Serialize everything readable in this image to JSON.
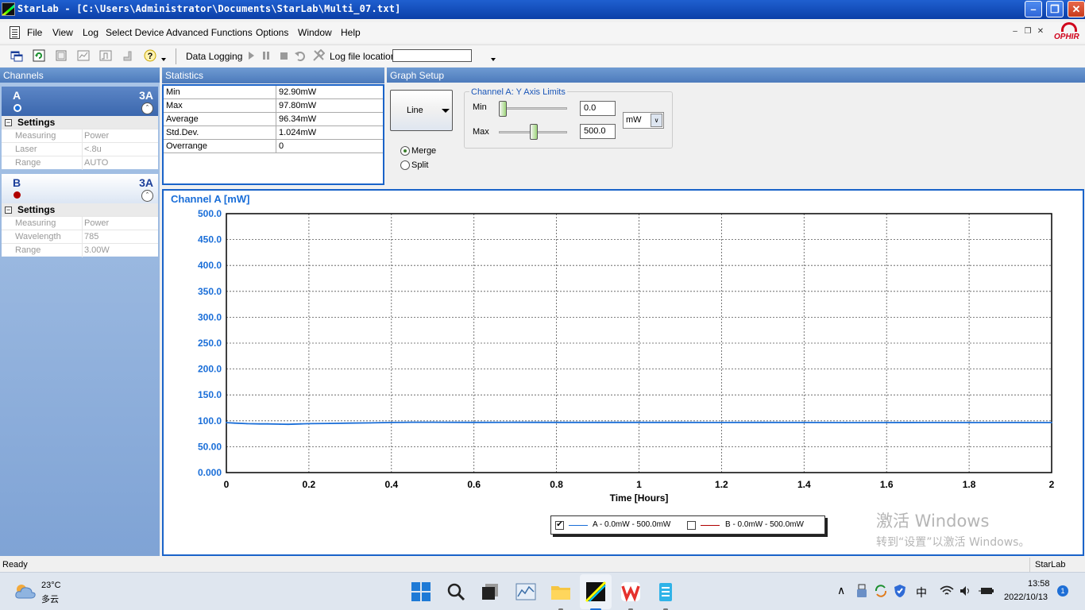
{
  "window": {
    "title": "StarLab - [C:\\Users\\Administrator\\Documents\\StarLab\\Multi_07.txt]",
    "min_glyph": "–",
    "max_glyph": "❐",
    "close_glyph": "✕"
  },
  "menu": {
    "items": [
      "File",
      "View",
      "Log",
      "Select Device",
      "Advanced Functions",
      "Options",
      "Window",
      "Help"
    ],
    "mdi_min": "–",
    "mdi_restore": "❐",
    "mdi_close": "✕",
    "brand": "OPHIR"
  },
  "toolbar": {
    "help_glyph": "?",
    "data_logging": "Data Logging",
    "log_file_location": "Log file location",
    "log_file_value": ""
  },
  "panels": {
    "channels": "Channels",
    "statistics": "Statistics",
    "graph_setup": "Graph Setup"
  },
  "channels": [
    {
      "letter": "A",
      "model": "3A",
      "color": "#1a6ed8",
      "settings_label": "Settings",
      "expander": "−",
      "collapse_glyph": "ˆ",
      "props": [
        {
          "k": "Measuring",
          "v": "Power"
        },
        {
          "k": "Laser",
          "v": "<.8u"
        },
        {
          "k": "Range",
          "v": "AUTO"
        }
      ]
    },
    {
      "letter": "B",
      "model": "3A",
      "color": "#b00000",
      "settings_label": "Settings",
      "expander": "−",
      "collapse_glyph": "ˆ",
      "props": [
        {
          "k": "Measuring",
          "v": "Power"
        },
        {
          "k": "Wavelength",
          "v": "785"
        },
        {
          "k": "Range",
          "v": "3.00W"
        }
      ]
    }
  ],
  "statistics": [
    {
      "k": "Min",
      "v": "92.90mW"
    },
    {
      "k": "Max",
      "v": "97.80mW"
    },
    {
      "k": "Average",
      "v": "96.34mW"
    },
    {
      "k": "Std.Dev.",
      "v": "1.024mW"
    },
    {
      "k": "Overrange",
      "v": "0"
    }
  ],
  "graph_setup": {
    "chart_type_button": "Line",
    "merge_label": "Merge",
    "split_label": "Split",
    "merge_selected": true,
    "y_limits_legend": "Channel A: Y Axis Limits",
    "min_label": "Min",
    "min_value": "0.0",
    "max_label": "Max",
    "max_value": "500.0",
    "unit": "mW",
    "dropdown_glyph": "∨"
  },
  "chart_data": {
    "type": "line",
    "title": "Channel A [mW]",
    "xlabel": "Time [Hours]",
    "ylabel": "",
    "xlim": [
      0,
      2
    ],
    "ylim": [
      0,
      500
    ],
    "x_ticks": [
      "0",
      "0.2",
      "0.4",
      "0.6",
      "0.8",
      "1",
      "1.2",
      "1.4",
      "1.6",
      "1.8",
      "2"
    ],
    "y_ticks": [
      "0.000",
      "50.00",
      "100.0",
      "150.0",
      "200.0",
      "250.0",
      "300.0",
      "350.0",
      "400.0",
      "450.0",
      "500.0"
    ],
    "grid": true,
    "legend_position": "bottom-right",
    "series": [
      {
        "name": "A - 0.0mW - 500.0mW",
        "color": "#1a6ed8",
        "checked": true,
        "x": [
          0,
          0.02,
          0.05,
          0.08,
          0.1,
          0.13,
          0.15,
          0.18,
          0.2,
          0.25,
          0.3,
          0.35,
          0.4,
          0.45,
          0.5,
          0.6,
          0.7,
          0.8,
          0.9,
          1.0,
          1.1,
          1.2,
          1.3,
          1.4,
          1.5,
          1.6,
          1.7,
          1.8,
          1.9,
          2.0
        ],
        "y": [
          96.5,
          95.5,
          94.5,
          94.0,
          94.0,
          93.5,
          93.2,
          94.0,
          94.5,
          95.0,
          95.5,
          96.0,
          96.8,
          97.2,
          97.3,
          97.0,
          97.1,
          97.0,
          96.9,
          97.0,
          96.9,
          96.8,
          96.9,
          96.8,
          96.7,
          96.7,
          96.8,
          96.7,
          96.8,
          96.7
        ]
      },
      {
        "name": "B - 0.0mW - 500.0mW",
        "color": "#b00000",
        "checked": false,
        "x": [],
        "y": []
      }
    ]
  },
  "legend": {
    "a_check": "✔",
    "b_check": ""
  },
  "watermark": {
    "line1": "激活 Windows",
    "line2": "转到“设置”以激活 Windows。"
  },
  "status": {
    "left": "Ready",
    "right": "StarLab"
  },
  "taskbar": {
    "weather_temp": "23°C",
    "weather_desc": "多云",
    "ime": "中",
    "time": "13:58",
    "date": "2022/10/13",
    "notifications": "1",
    "tray_chevron": "∧"
  }
}
